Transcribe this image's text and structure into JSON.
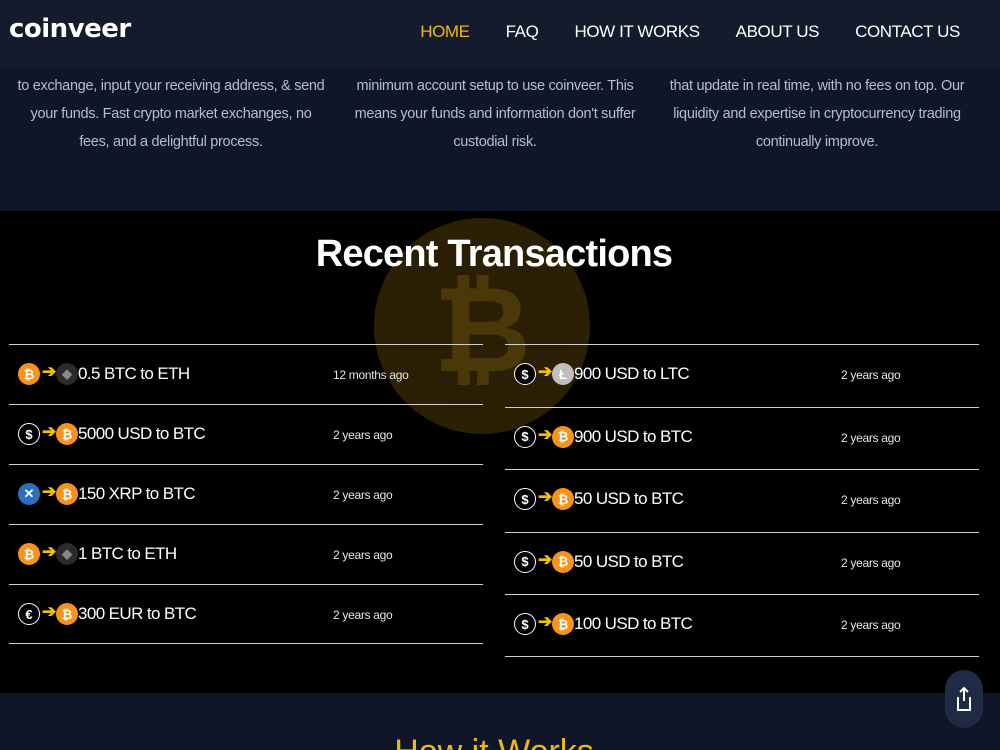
{
  "brand": {
    "logo": "coinveer"
  },
  "nav": {
    "items": [
      {
        "label": "HOME",
        "active": true
      },
      {
        "label": "FAQ",
        "active": false
      },
      {
        "label": "HOW IT WORKS",
        "active": false
      },
      {
        "label": "ABOUT US",
        "active": false
      },
      {
        "label": "CONTACT US",
        "active": false
      }
    ]
  },
  "features": [
    {
      "text": "to exchange, input your receiving address, & send your funds. Fast crypto market exchanges, no fees, and a delightful process."
    },
    {
      "text": "minimum account setup to use coinveer. This means your funds and information don't suffer custodial risk."
    },
    {
      "text": "that update in real time, with no fees on top. Our liquidity and expertise in cryptocurrency trading continually improve."
    }
  ],
  "transactions": {
    "title": "Recent Transactions",
    "left": [
      {
        "from": "btc",
        "to": "eth",
        "pair": "0.5 BTC to ETH",
        "time": "12 months ago"
      },
      {
        "from": "usd",
        "to": "btc",
        "pair": "5000 USD to BTC",
        "time": "2 years ago"
      },
      {
        "from": "xrp",
        "to": "btc",
        "pair": "150 XRP to BTC",
        "time": "2 years ago"
      },
      {
        "from": "btc",
        "to": "eth",
        "pair": "1 BTC to ETH",
        "time": "2 years ago"
      },
      {
        "from": "eur",
        "to": "btc",
        "pair": "300 EUR to BTC",
        "time": "2 years ago"
      }
    ],
    "right": [
      {
        "from": "usd",
        "to": "ltc",
        "pair": "900 USD to LTC",
        "time": "2 years ago"
      },
      {
        "from": "usd",
        "to": "btc",
        "pair": "900 USD to BTC",
        "time": "2 years ago"
      },
      {
        "from": "usd",
        "to": "btc",
        "pair": "50 USD to BTC",
        "time": "2 years ago"
      },
      {
        "from": "usd",
        "to": "btc",
        "pair": "50 USD to BTC",
        "time": "2 years ago"
      },
      {
        "from": "usd",
        "to": "btc",
        "pair": "100 USD to BTC",
        "time": "2 years ago"
      }
    ]
  },
  "icons": {
    "btc": "bitcoin-icon",
    "eth": "ethereum-icon",
    "usd": "dollar-icon",
    "xrp": "ripple-icon",
    "eur": "euro-icon",
    "ltc": "litecoin-icon",
    "arrow": "arrow-right-icon",
    "share": "share-icon"
  },
  "how": {
    "title": "How it Works"
  },
  "colors": {
    "accent": "#f0b90b",
    "nav_bg": "#141b2d",
    "section_bg": "#0e1628",
    "btc": "#f7931a"
  }
}
